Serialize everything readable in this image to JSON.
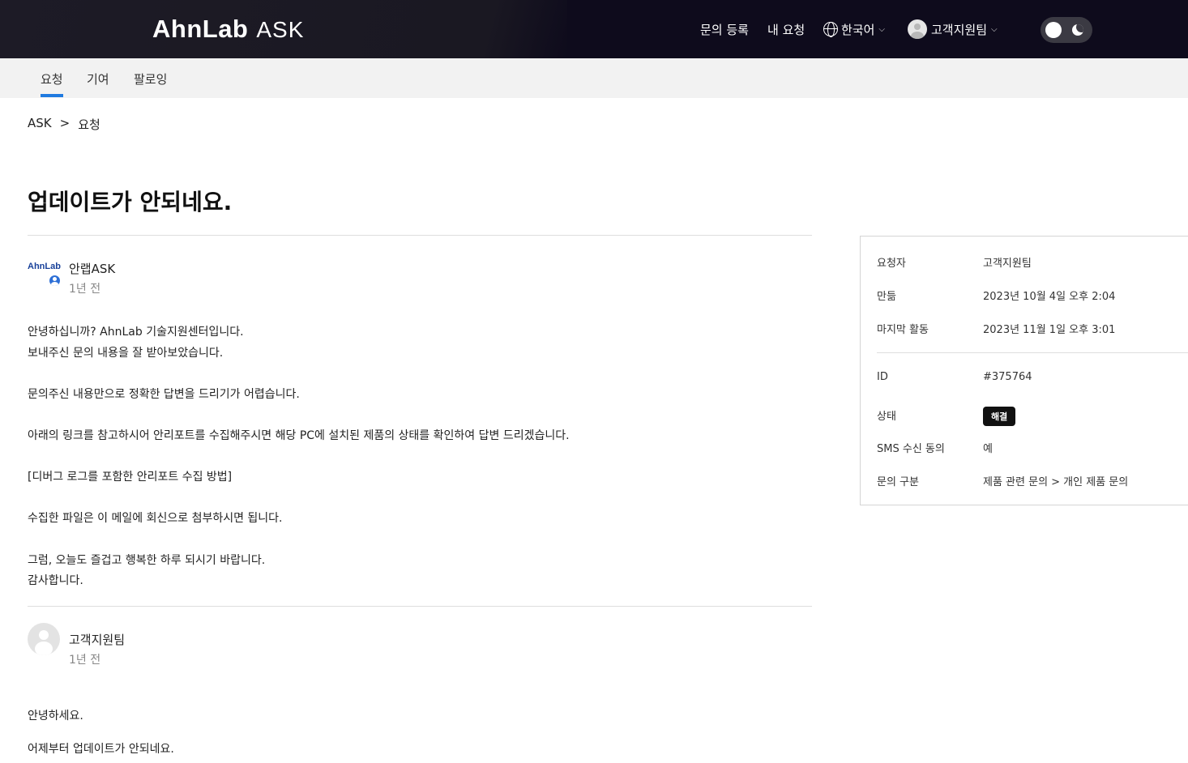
{
  "header": {
    "brand": "AhnLab",
    "brand_sub": "ASK",
    "nav": {
      "submit_request": "문의 등록",
      "my_requests": "내 요청",
      "language": "한국어",
      "user": "고객지원팀"
    },
    "theme": "dark"
  },
  "subtabs": {
    "requests": "요청",
    "contributions": "기여",
    "following": "팔로잉"
  },
  "breadcrumb": {
    "root": "ASK",
    "sep": ">",
    "current": "요청"
  },
  "page_title": "업데이트가 안되네요.",
  "comments": [
    {
      "avatar_text": "AhnLab",
      "author": "안랩ASK",
      "time": "1년 전",
      "lines": [
        "안녕하십니까? AhnLab 기술지원센터입니다.",
        "보내주신 문의 내용을 잘 받아보았습니다.",
        "문의주신 내용만으로 정확한 답변을 드리기가 어렵습니다.",
        "아래의 링크를 참고하시어 안리포트를 수집해주시면 해당 PC에 설치된 제품의 상태를 확인하여 답변 드리겠습니다.",
        "[디버그 로그를 포함한 안리포트 수집 방법]",
        "수집한 파일은 이 메일에 회신으로 첨부하시면 됩니다.",
        "그럼, 오늘도 즐겁고 행복한 하루 되시기 바랍니다.",
        "감사합니다."
      ]
    },
    {
      "author": "고객지원팀",
      "time": "1년 전",
      "lines": [
        "안녕하세요.",
        "어제부터 업데이트가 안되네요."
      ]
    }
  ],
  "sidebar": {
    "requester": {
      "label": "요청자",
      "value": "고객지원팀"
    },
    "created": {
      "label": "만듦",
      "value": "2023년 10월 4일 오후 2:04"
    },
    "last_activity": {
      "label": "마지막 활동",
      "value": "2023년 11월 1일 오후 3:01"
    },
    "id": {
      "label": "ID",
      "value": "#375764"
    },
    "status": {
      "label": "상태",
      "value": "해결"
    },
    "sms_consent": {
      "label": "SMS 수신 동의",
      "value": "예"
    },
    "category": {
      "label": "문의 구분",
      "value": "제품 관련 문의 > 개인 제품 문의"
    }
  }
}
